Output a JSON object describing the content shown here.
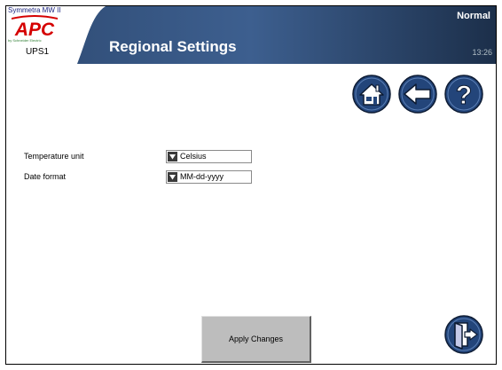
{
  "header": {
    "product_name": "Symmetra MW II",
    "logo_text": "APC",
    "logo_tagline": "by Schneider Electric",
    "device_name": "UPS1",
    "page_title": "Regional Settings",
    "status": "Normal",
    "clock": "13:26"
  },
  "nav": {
    "home_icon": "home-icon",
    "back_icon": "back-arrow-icon",
    "help_icon": "question-mark-icon",
    "exit_icon": "exit-door-icon"
  },
  "settings": [
    {
      "label": "Temperature unit",
      "value": "Celsius"
    },
    {
      "label": "Date format",
      "value": "MM-dd-yyyy"
    }
  ],
  "actions": {
    "apply_label": "Apply Changes"
  },
  "colors": {
    "header_dark": "#1c2f4a",
    "header_mid": "#2e4a72",
    "button_blue": "#23457a",
    "apc_red": "#d50000",
    "apply_gray": "#bdbdbd"
  }
}
